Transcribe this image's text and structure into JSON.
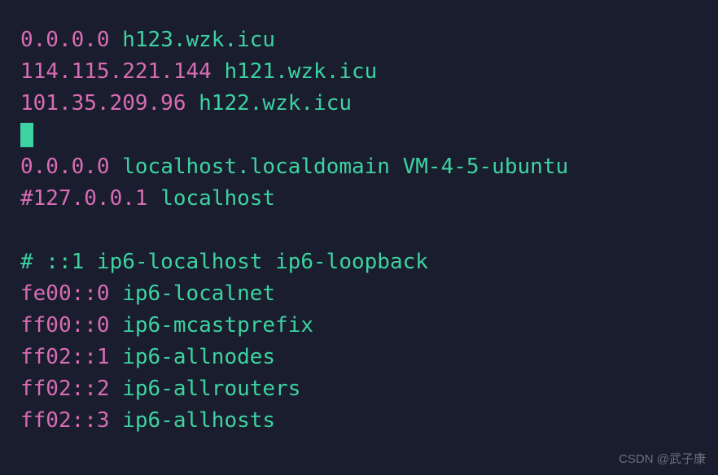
{
  "lines": [
    {
      "ip": "0.0.0.0",
      "host": "h123.wzk.icu"
    },
    {
      "ip": "114.115.221.144",
      "host": "h121.wzk.icu"
    },
    {
      "ip": "101.35.209.96",
      "host": "h122.wzk.icu"
    }
  ],
  "line4_ip": "0.0.0.0",
  "line4_host": "localhost.localdomain VM-4-5-ubuntu",
  "line5_ip": "#127.0.0.1",
  "line5_host": "localhost",
  "comment_line": "# ::1 ip6-localhost ip6-loopback",
  "ipv6_lines": [
    {
      "ip": "fe00::0",
      "host": "ip6-localnet"
    },
    {
      "ip": "ff00::0",
      "host": "ip6-mcastprefix"
    },
    {
      "ip": "ff02::1",
      "host": "ip6-allnodes"
    },
    {
      "ip": "ff02::2",
      "host": "ip6-allrouters"
    },
    {
      "ip": "ff02::3",
      "host": "ip6-allhosts"
    }
  ],
  "watermark": "CSDN @武子康"
}
